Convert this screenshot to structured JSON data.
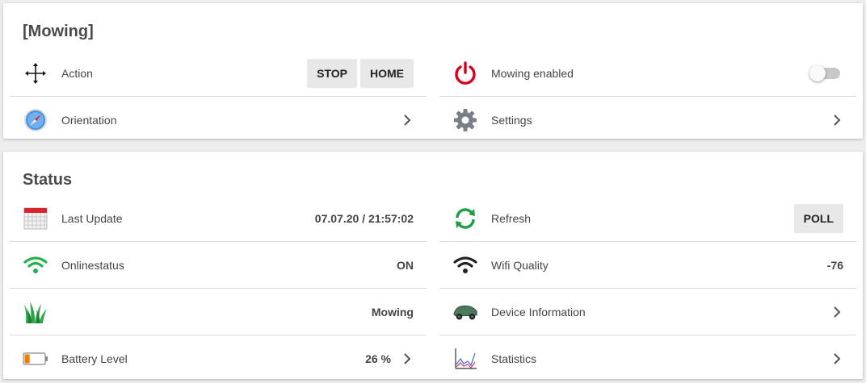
{
  "mowing_card": {
    "title": "[Mowing]",
    "action": {
      "label": "Action",
      "stop": "STOP",
      "home": "HOME"
    },
    "mowing_enabled": {
      "label": "Mowing enabled",
      "state": "off"
    },
    "orientation": {
      "label": "Orientation"
    },
    "settings": {
      "label": "Settings"
    }
  },
  "status_card": {
    "title": "Status",
    "last_update": {
      "label": "Last Update",
      "value": "07.07.20 / 21:57:02"
    },
    "refresh": {
      "label": "Refresh",
      "button": "POLL"
    },
    "onlinestatus": {
      "label": "Onlinestatus",
      "value": "ON"
    },
    "wifi_quality": {
      "label": "Wifi Quality",
      "value": "-76"
    },
    "mower_state": {
      "value": "Mowing"
    },
    "device_information": {
      "label": "Device Information"
    },
    "battery_level": {
      "label": "Battery Level",
      "value": "26 %",
      "level": 0.26
    },
    "statistics": {
      "label": "Statistics"
    }
  },
  "colors": {
    "power_icon": "#d6001c",
    "refresh_icon": "#1e9e4a",
    "wifi_online": "#23b14d",
    "battery_low": "#f07c00",
    "grass": "#2fa34a"
  }
}
